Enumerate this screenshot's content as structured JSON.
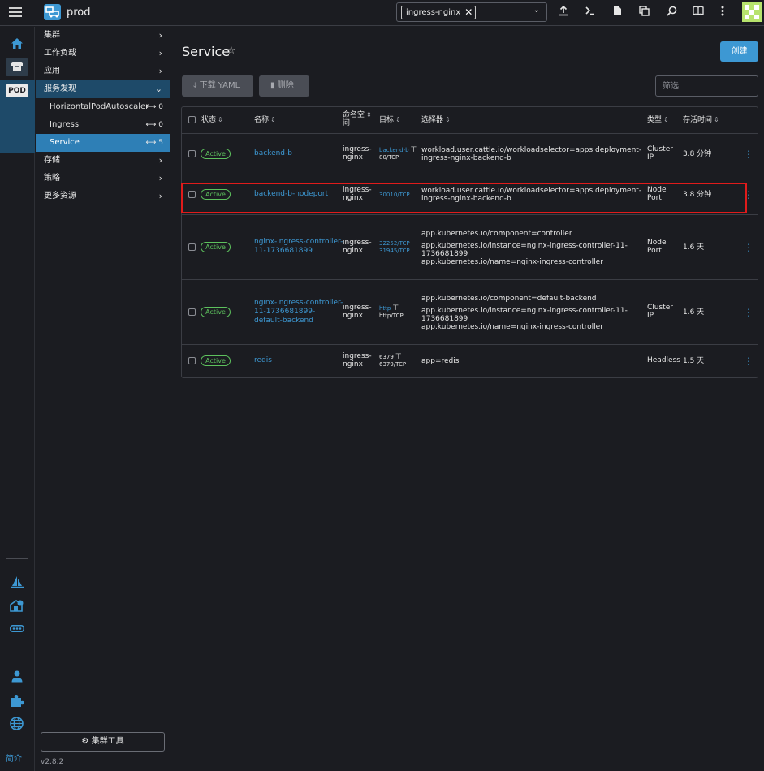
{
  "topbar": {
    "cluster_name": "prod",
    "namespace_chip": "ingress-nginx",
    "icons": [
      "import-yaml-icon",
      "kubectl-shell-icon",
      "kubeconfig-download-icon",
      "copy-kubeconfig-icon",
      "search-icon",
      "docs-icon",
      "more-icon"
    ]
  },
  "rail": {
    "pod_badge": "POD",
    "footer": "简介"
  },
  "sidenav": {
    "groups": [
      {
        "label": "集群"
      },
      {
        "label": "工作负载"
      },
      {
        "label": "应用"
      },
      {
        "label": "服务发现"
      },
      {
        "label": "存储"
      },
      {
        "label": "策略"
      },
      {
        "label": "更多资源"
      }
    ],
    "children": [
      {
        "label": "HorizontalPodAutoscaler",
        "count": "0"
      },
      {
        "label": "Ingress",
        "count": "0"
      },
      {
        "label": "Service",
        "count": "5"
      }
    ],
    "tools_button": "集群工具",
    "version": "v2.8.2"
  },
  "page": {
    "title": "Service",
    "create_button": "创建",
    "download_yaml": "下载 YAML",
    "delete": "删除",
    "filter_placeholder": "筛选"
  },
  "table": {
    "headers": {
      "state": "状态",
      "name": "名称",
      "namespace_line1": "命名空",
      "namespace_line2": "间",
      "target": "目标",
      "selector": "选择器",
      "type": "类型",
      "age": "存活时间"
    },
    "rows": [
      {
        "state": "Active",
        "name_lines": [
          "backend-b"
        ],
        "namespace_lines": [
          "ingress-",
          "nginx"
        ],
        "target": [
          {
            "text": "backend-b",
            "style": "link",
            "icon": true
          },
          {
            "text": "80/TCP",
            "style": "plain"
          }
        ],
        "selector_lines": [
          "workload.user.cattle.io/workloadselector=apps.deployment-",
          "ingress-nginx-backend-b"
        ],
        "type_lines": [
          "Cluster",
          "IP"
        ],
        "age": "3.8 分钟"
      },
      {
        "state": "Active",
        "name_lines": [
          "backend-b-nodeport"
        ],
        "namespace_lines": [
          "ingress-",
          "nginx"
        ],
        "target": [
          {
            "text": "30010/TCP",
            "style": "link",
            "icon": false
          }
        ],
        "selector_lines": [
          "workload.user.cattle.io/workloadselector=apps.deployment-",
          "ingress-nginx-backend-b"
        ],
        "type_lines": [
          "Node",
          "Port"
        ],
        "age": "3.8 分钟"
      },
      {
        "state": "Active",
        "name_lines": [
          "nginx-ingress-controller-",
          "11-1736681899"
        ],
        "namespace_lines": [
          "ingress-",
          "nginx"
        ],
        "target": [
          {
            "text": "32252/TCP",
            "style": "link",
            "icon": false
          },
          {
            "text": "31945/TCP",
            "style": "link",
            "icon": false
          }
        ],
        "selector_lines": [
          "app.kubernetes.io/component=controller",
          "",
          "app.kubernetes.io/instance=nginx-ingress-controller-11-",
          "1736681899",
          "app.kubernetes.io/name=nginx-ingress-controller"
        ],
        "type_lines": [
          "Node",
          "Port"
        ],
        "age": "1.6 天"
      },
      {
        "state": "Active",
        "name_lines": [
          "nginx-ingress-controller-",
          "11-1736681899-",
          "default-backend"
        ],
        "namespace_lines": [
          "ingress-",
          "nginx"
        ],
        "target": [
          {
            "text": "http",
            "style": "link",
            "icon": true
          },
          {
            "text": "http/TCP",
            "style": "plain"
          }
        ],
        "selector_lines": [
          "app.kubernetes.io/component=default-backend",
          "",
          "app.kubernetes.io/instance=nginx-ingress-controller-11-",
          "1736681899",
          "app.kubernetes.io/name=nginx-ingress-controller"
        ],
        "type_lines": [
          "Cluster",
          "IP"
        ],
        "age": "1.6 天"
      },
      {
        "state": "Active",
        "name_lines": [
          "redis"
        ],
        "namespace_lines": [
          "ingress-",
          "nginx"
        ],
        "target": [
          {
            "text": "6379",
            "style": "plain",
            "icon": true
          },
          {
            "text": "6379/TCP",
            "style": "plain"
          }
        ],
        "selector_lines": [
          "app=redis"
        ],
        "type_lines": [
          "Headless"
        ],
        "age": "1.5 天"
      }
    ]
  },
  "colors": {
    "accent": "#3d98d3",
    "active_nav": "#2e7fb6",
    "badge_green": "#5dc15d",
    "highlight_red": "#e01b1b",
    "background": "#1b1c21"
  }
}
